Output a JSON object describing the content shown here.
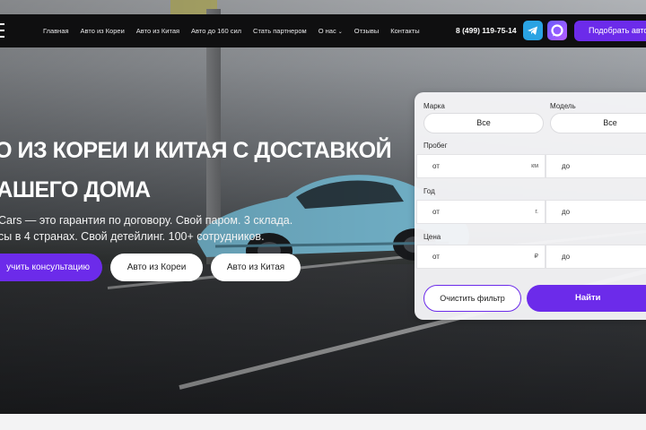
{
  "nav": {
    "links": [
      "Главная",
      "Авто из Кореи",
      "Авто из Китая",
      "Авто до 160 сил",
      "Стать партнером",
      "О нас",
      "Отзывы",
      "Контакты"
    ],
    "phone": "8 (499) 119-75-14",
    "cta": "Подобрать авто",
    "icons": [
      "telegram-icon",
      "max-messenger-icon"
    ]
  },
  "hero": {
    "title_line1": "то из Кореи и Китая с доставкой",
    "title_line2": "вашего дома",
    "subtitle_line1": "Cars — это гарантия по договору. Свой паром. 3 склада.",
    "subtitle_line2": "сы в 4 странах. Свой детейлинг. 100+ сотрудников.",
    "btn_primary": "учить консультацию",
    "btn_korea": "Авто из Кореи",
    "btn_china": "Авто из Китая"
  },
  "filter": {
    "brand_label": "Марка",
    "brand_value": "Все",
    "model_label": "Модель",
    "model_value": "Все",
    "mileage_label": "Пробег",
    "mileage_from": "от",
    "mileage_unit": "км",
    "mileage_to": "до",
    "year_label": "Год",
    "year_from": "от",
    "year_unit": "г.",
    "year_to": "до",
    "price_label": "Цена",
    "price_from": "от",
    "price_unit": "₽",
    "price_to": "до",
    "clear": "Очистить фильтр",
    "find": "Найти"
  },
  "colors": {
    "accent": "#6c2bea",
    "navbar": "#0f0f10",
    "telegram": "#2aa3e3"
  }
}
